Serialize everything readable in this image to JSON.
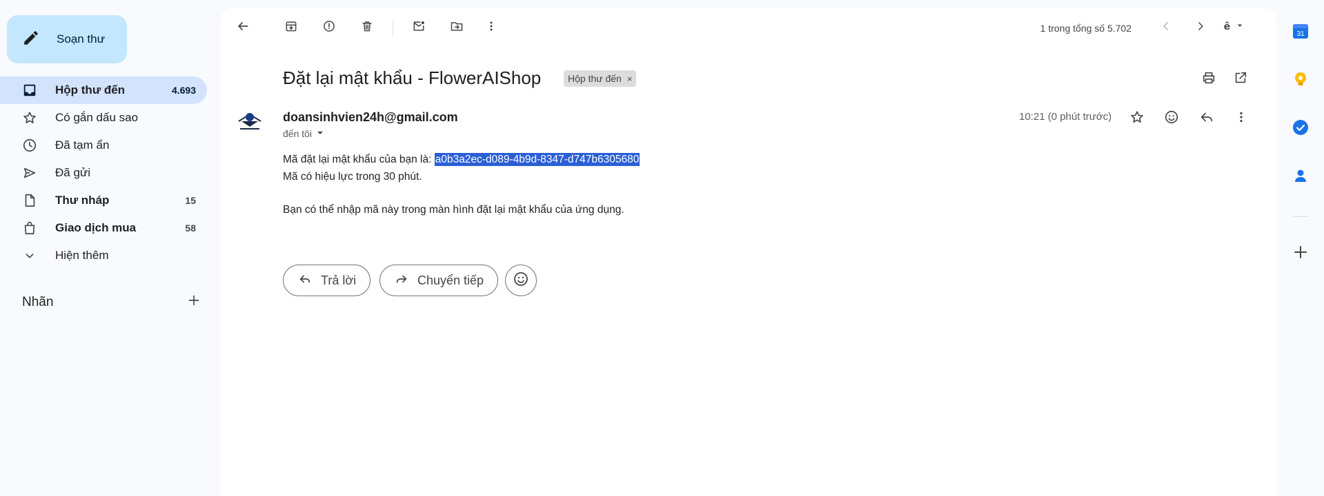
{
  "sidebar": {
    "compose_label": "Soạn thư",
    "items": [
      {
        "label": "Hộp thư đến",
        "count": "4.693",
        "icon": "inbox-icon"
      },
      {
        "label": "Có gắn dấu sao",
        "count": "",
        "icon": "star-icon"
      },
      {
        "label": "Đã tạm ẩn",
        "count": "",
        "icon": "clock-icon"
      },
      {
        "label": "Đã gửi",
        "count": "",
        "icon": "send-icon"
      },
      {
        "label": "Thư nháp",
        "count": "15",
        "icon": "draft-icon"
      },
      {
        "label": "Giao dịch mua",
        "count": "58",
        "icon": "shopping-bag-icon"
      },
      {
        "label": "Hiện thêm",
        "count": "",
        "icon": "chevron-down-icon"
      }
    ],
    "labels_title": "Nhãn"
  },
  "toolbar": {
    "pagination": "1 trong tổng số 5.702"
  },
  "email": {
    "subject": "Đặt lại mật khẩu - FlowerAIShop",
    "label_chip": "Hộp thư đến",
    "label_chip_close": "×",
    "sender": "doansinhvien24h@gmail.com",
    "to": "đến tôi",
    "time": "10:21 (0 phút trước)",
    "body_line1_prefix": "Mã đặt lại mật khẩu của bạn là: ",
    "reset_code": "a0b3a2ec-d089-4b9d-8347-d747b6305680",
    "body_line2": "Mã có hiệu lực trong 30 phút.",
    "body_line3": "Bạn có thể nhập mã này trong màn hình đặt lại mật khẩu của ứng dụng."
  },
  "actions": {
    "reply_label": "Trả lời",
    "forward_label": "Chuyển tiếp"
  },
  "rightbar": {
    "calendar_day": "31"
  },
  "colors": {
    "compose_bg": "#c2e7ff",
    "active_nav_bg": "#d3e3fd",
    "selection": "#2b5fd6",
    "keep_yellow": "#fbbc04",
    "tasks_blue": "#1a73e8"
  }
}
